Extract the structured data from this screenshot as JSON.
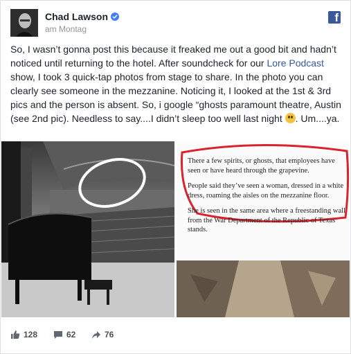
{
  "post": {
    "author": "Chad Lawson",
    "timestamp": "am Montag",
    "verified_icon": "verified-badge-icon",
    "platform_icon": "facebook-logo-icon",
    "text_part1": "So, I wasn’t gonna post this because it freaked me out a good bit and hadn’t noticed until returning to the hotel. After soundcheck for our ",
    "link_text": "Lore Podcast",
    "text_part2": " show, I took 3 quick-tap photos from stage to share. In the photo you can clearly see someone in the mezzanine. Noticing it, I looked at the 1st & 3rd pics and the person is absent. So, i google “ghosts paramount theatre, Austin (see 2nd pic). Needless to say....I didn’t sleep too well last night ",
    "text_part3": ". Um....ya.",
    "emoji": "flushed-face-emoji"
  },
  "article": {
    "p1": "There a few spirits, or ghosts, that employees have seen or have heard through the grapevine.",
    "p2": "People said they’ve seen a woman, dressed in a white dress, roaming the aisles on the mezzanine floor.",
    "p3": "She is seen in the same area where a freestanding wall from the War Department of the Republic of Texas stands."
  },
  "stats": {
    "likes": "128",
    "comments": "62",
    "shares": "76"
  },
  "colors": {
    "link": "#365899",
    "accent": "#4080ff",
    "facebook": "#3b5998",
    "circle": "#d9232e"
  }
}
